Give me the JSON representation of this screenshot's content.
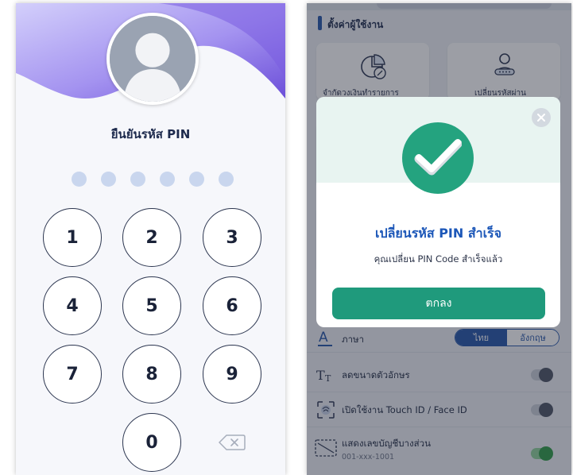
{
  "pin_screen": {
    "title": "ยืนยันรหัส PIN",
    "pin_length": 6,
    "keys": [
      "1",
      "2",
      "3",
      "4",
      "5",
      "6",
      "7",
      "8",
      "9",
      "0"
    ],
    "avatar_icon": "user-silhouette-icon",
    "backspace_icon": "backspace-icon",
    "colors": {
      "wave_start": "#b7b9f5",
      "wave_end": "#7a5ce0",
      "dot": "#c9d6ee",
      "key_border": "#2c3650"
    }
  },
  "settings_screen": {
    "section_title": "ตั้งค่าผู้ใช้งาน",
    "tiles": [
      {
        "label": "จำกัดวงเงินทำรายการ",
        "icon": "pie-chart-percent-icon"
      },
      {
        "label": "เปลี่ยนรหัสผ่าน",
        "icon": "user-key-icon"
      }
    ],
    "rows": [
      {
        "label": "ภาษา",
        "icon": "font-a-icon",
        "type": "language"
      },
      {
        "label": "ลดขนาดตัวอักษร",
        "icon": "text-size-icon",
        "type": "toggle",
        "on": false
      },
      {
        "label": "เปิดใช้งาน Touch ID / Face ID",
        "icon": "face-id-icon",
        "type": "toggle",
        "on": false
      },
      {
        "label": "แสดงเลขบัญชีบางส่วน",
        "sub": "001-xxx-1001",
        "icon": "masked-account-icon",
        "type": "toggle",
        "on": true
      }
    ],
    "language": {
      "options": [
        "ไทย",
        "อังกฤษ"
      ],
      "selected": "ไทย"
    },
    "colors": {
      "accent": "#2455a8",
      "toggle_on": "#2f9c45"
    }
  },
  "modal": {
    "title": "เปลี่ยนรหัส PIN สำเร็จ",
    "message": "คุณเปลี่ยน PIN Code สำเร็จแล้ว",
    "ok_label": "ตกลง",
    "icon": "check-circle-icon",
    "close_icon": "close-icon",
    "colors": {
      "badge": "#24a37f",
      "title": "#1c57b8",
      "button": "#1f9a7c"
    }
  }
}
